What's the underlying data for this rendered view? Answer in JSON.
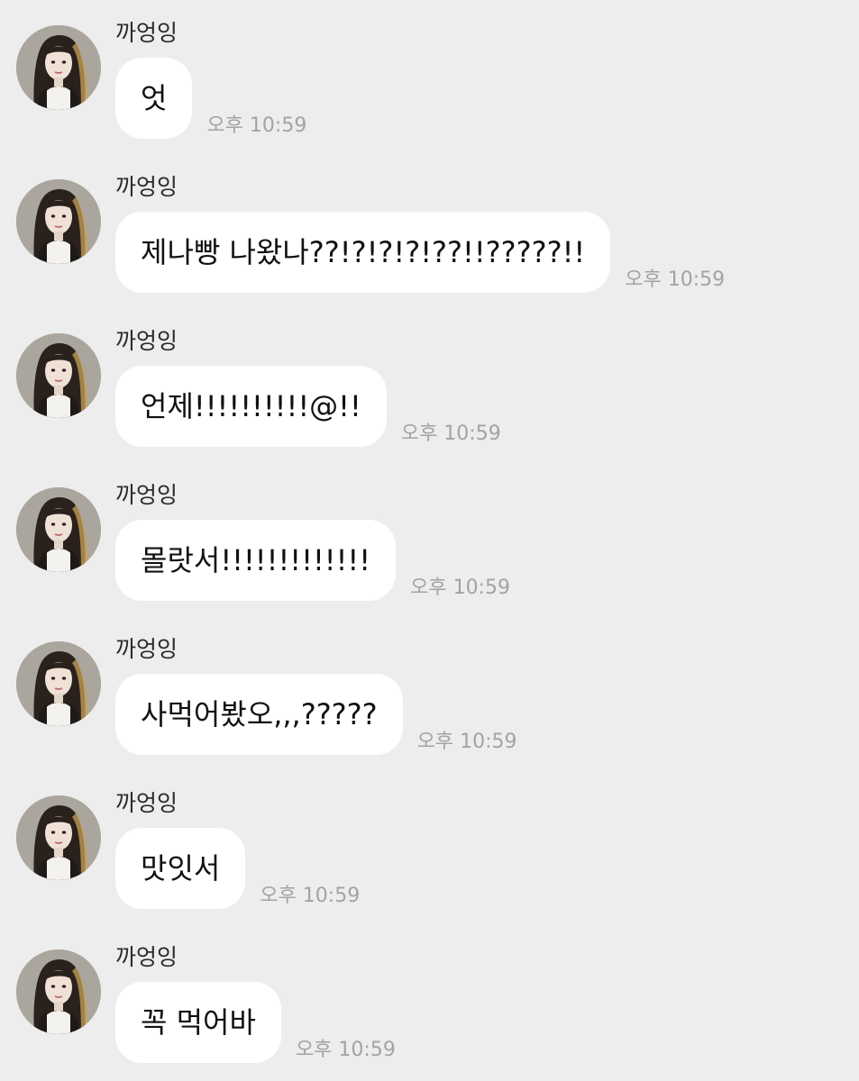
{
  "chat": {
    "messages": [
      {
        "sender": "까엉잉",
        "text": "엇",
        "time": "오후 10:59"
      },
      {
        "sender": "까엉잉",
        "text": "제나빵 나왔나??!?!?!?!??!!?????!!",
        "time": "오후 10:59"
      },
      {
        "sender": "까엉잉",
        "text": "언제!!!!!!!!!!@!!",
        "time": "오후 10:59"
      },
      {
        "sender": "까엉잉",
        "text": "몰랏서!!!!!!!!!!!!!",
        "time": "오후 10:59"
      },
      {
        "sender": "까엉잉",
        "text": "사먹어봤오,,,?????",
        "time": "오후 10:59"
      },
      {
        "sender": "까엉잉",
        "text": "맛잇서",
        "time": "오후 10:59"
      },
      {
        "sender": "까엉잉",
        "text": "꼭 먹어바",
        "time": "오후 10:59"
      }
    ]
  },
  "colors": {
    "background": "#ededed",
    "bubble": "#ffffff",
    "text": "#111111",
    "timestamp": "#a3a3a3"
  },
  "icons": {
    "avatar": "profile-photo"
  }
}
